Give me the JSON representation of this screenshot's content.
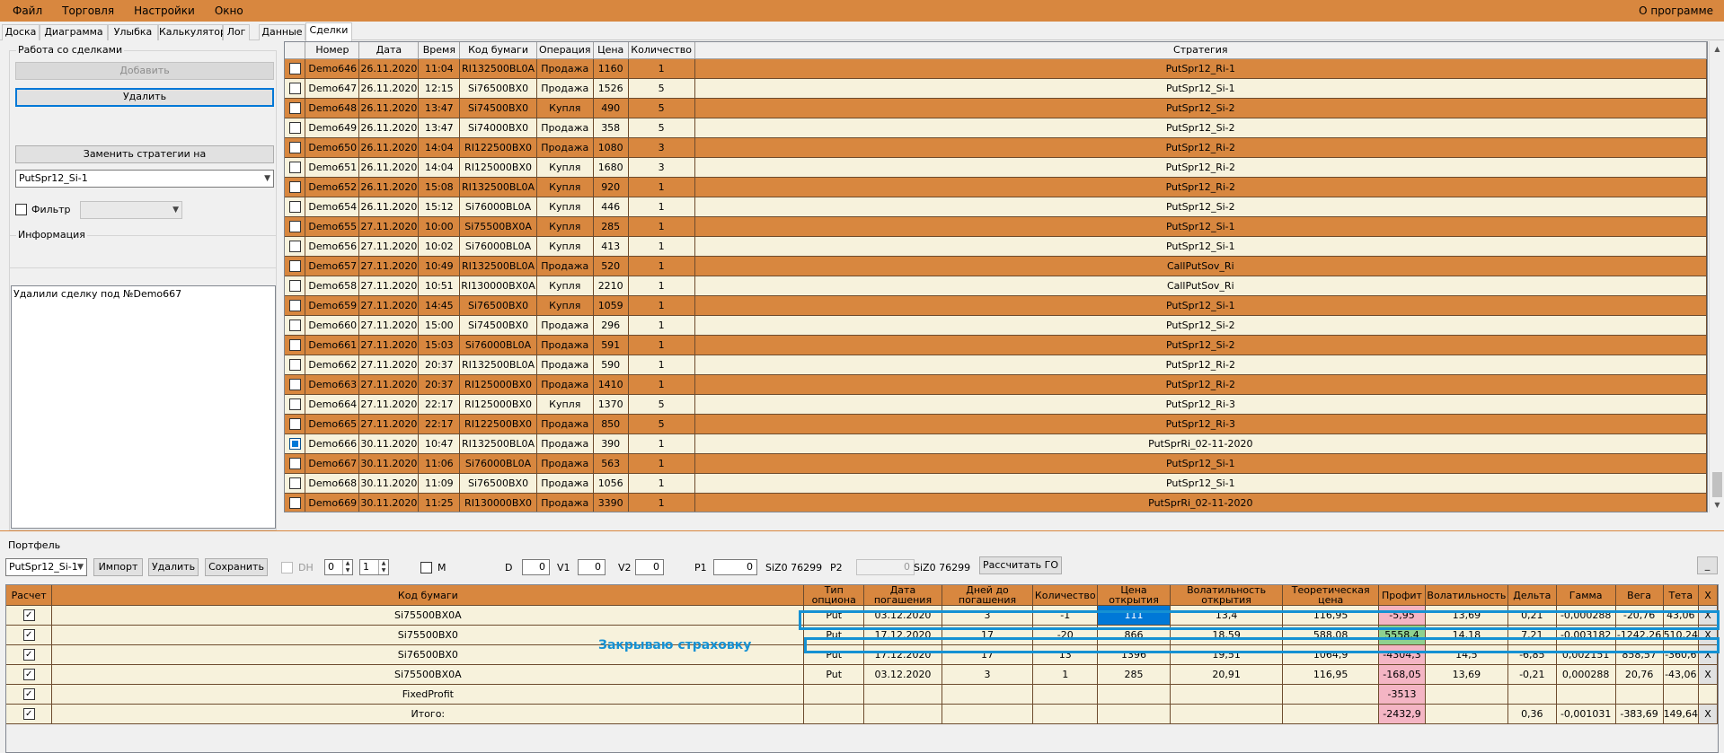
{
  "menu": {
    "items": [
      "Файл",
      "Торговля",
      "Настройки",
      "Окно"
    ],
    "about": "О программе"
  },
  "tabs": [
    "Доска",
    "Диаграмма",
    "Улыбка",
    "Калькулятор",
    "Лог",
    "Данные",
    "Сделки"
  ],
  "active_tab": "Сделки",
  "deals_panel": {
    "title": "Работа со сделками",
    "add_label": "Добавить",
    "delete_label": "Удалить",
    "replace_label": "Заменить стратегии на",
    "strategy_value": "PutSpr12_Si-1",
    "filter_label": "Фильтр",
    "filter_value": ""
  },
  "info": {
    "title": "Информация",
    "text": "Удалили сделку под №Demo667"
  },
  "deals": {
    "columns": [
      "",
      "Номер",
      "Дата",
      "Время",
      "Код бумаги",
      "Операция",
      "Цена",
      "Количество",
      "Стратегия"
    ],
    "rows": [
      [
        "Demo646",
        "26.11.2020",
        "11:04",
        "RI132500BL0A",
        "Продажа",
        "1160",
        "1",
        "PutSpr12_Ri-1"
      ],
      [
        "Demo647",
        "26.11.2020",
        "12:15",
        "Si76500BX0",
        "Продажа",
        "1526",
        "5",
        "PutSpr12_Si-1"
      ],
      [
        "Demo648",
        "26.11.2020",
        "13:47",
        "Si74500BX0",
        "Купля",
        "490",
        "5",
        "PutSpr12_Si-2"
      ],
      [
        "Demo649",
        "26.11.2020",
        "13:47",
        "Si74000BX0",
        "Продажа",
        "358",
        "5",
        "PutSpr12_Si-2"
      ],
      [
        "Demo650",
        "26.11.2020",
        "14:04",
        "RI122500BX0",
        "Продажа",
        "1080",
        "3",
        "PutSpr12_Ri-2"
      ],
      [
        "Demo651",
        "26.11.2020",
        "14:04",
        "RI125000BX0",
        "Купля",
        "1680",
        "3",
        "PutSpr12_Ri-2"
      ],
      [
        "Demo652",
        "26.11.2020",
        "15:08",
        "RI132500BL0A",
        "Купля",
        "920",
        "1",
        "PutSpr12_Ri-2"
      ],
      [
        "Demo654",
        "26.11.2020",
        "15:12",
        "Si76000BL0A",
        "Купля",
        "446",
        "1",
        "PutSpr12_Si-2"
      ],
      [
        "Demo655",
        "27.11.2020",
        "10:00",
        "Si75500BX0A",
        "Купля",
        "285",
        "1",
        "PutSpr12_Si-1"
      ],
      [
        "Demo656",
        "27.11.2020",
        "10:02",
        "Si76000BL0A",
        "Купля",
        "413",
        "1",
        "PutSpr12_Si-1"
      ],
      [
        "Demo657",
        "27.11.2020",
        "10:49",
        "RI132500BL0A",
        "Продажа",
        "520",
        "1",
        "CallPutSov_Ri"
      ],
      [
        "Demo658",
        "27.11.2020",
        "10:51",
        "RI130000BX0A",
        "Купля",
        "2210",
        "1",
        "CallPutSov_Ri"
      ],
      [
        "Demo659",
        "27.11.2020",
        "14:45",
        "Si76500BX0",
        "Купля",
        "1059",
        "1",
        "PutSpr12_Si-1"
      ],
      [
        "Demo660",
        "27.11.2020",
        "15:00",
        "Si74500BX0",
        "Продажа",
        "296",
        "1",
        "PutSpr12_Si-2"
      ],
      [
        "Demo661",
        "27.11.2020",
        "15:03",
        "Si76000BL0A",
        "Продажа",
        "591",
        "1",
        "PutSpr12_Si-2"
      ],
      [
        "Demo662",
        "27.11.2020",
        "20:37",
        "RI132500BL0A",
        "Продажа",
        "590",
        "1",
        "PutSpr12_Ri-2"
      ],
      [
        "Demo663",
        "27.11.2020",
        "20:37",
        "RI125000BX0",
        "Продажа",
        "1410",
        "1",
        "PutSpr12_Ri-2"
      ],
      [
        "Demo664",
        "27.11.2020",
        "22:17",
        "RI125000BX0",
        "Купля",
        "1370",
        "5",
        "PutSpr12_Ri-3"
      ],
      [
        "Demo665",
        "27.11.2020",
        "22:17",
        "RI122500BX0",
        "Продажа",
        "850",
        "5",
        "PutSpr12_Ri-3"
      ],
      [
        "Demo666",
        "30.11.2020",
        "10:47",
        "RI132500BL0A",
        "Продажа",
        "390",
        "1",
        "PutSprRi_02-11-2020"
      ],
      [
        "Demo667",
        "30.11.2020",
        "11:06",
        "Si76000BL0A",
        "Продажа",
        "563",
        "1",
        "PutSpr12_Si-1"
      ],
      [
        "Demo668",
        "30.11.2020",
        "11:09",
        "Si76500BX0",
        "Продажа",
        "1056",
        "1",
        "PutSpr12_Si-1"
      ],
      [
        "Demo669",
        "30.11.2020",
        "11:25",
        "RI130000BX0",
        "Продажа",
        "3390",
        "1",
        "PutSprRi_02-11-2020"
      ]
    ],
    "selected_row": 19
  },
  "portfolio": {
    "title": "Портфель",
    "select_value": "PutSpr12_Si-1",
    "import_label": "Импорт",
    "delete_label": "Удалить",
    "save_label": "Сохранить",
    "dh_label": "DH",
    "dh_val1": "0",
    "dh_val2": "1",
    "m_label": "M",
    "d_label": "D",
    "d_value": "0",
    "v1_label": "V1",
    "v1_value": "0",
    "v2_label": "V2",
    "v2_value": "0",
    "p1_label": "P1",
    "p1_value": "0",
    "sizo1": "SiZ0 76299",
    "p2_label": "P2",
    "p2_value": "0",
    "sizo2": "SiZ0 76299",
    "calc_label": "Рассчитать ГО",
    "min_label": "_",
    "annotation": "Закрываю страховку",
    "columns": [
      "Расчет",
      "Код бумаги",
      "Тип опциона",
      "Дата погашения",
      "Дней до погашения",
      "Количество",
      "Цена открытия",
      "Волатильность открытия",
      "Теоретическая цена",
      "Профит",
      "Волатильность",
      "Дельта",
      "Гамма",
      "Вега",
      "Тета",
      "X"
    ],
    "rows": [
      [
        "Si75500BX0A",
        "Put",
        "03.12.2020",
        "3",
        "-1",
        "111",
        "13,4",
        "116,95",
        "-5,95",
        "13,69",
        "0,21",
        "-0,000288",
        "-20,76",
        "43,06",
        "X"
      ],
      [
        "Si75500BX0",
        "Put",
        "17.12.2020",
        "17",
        "-20",
        "866",
        "18,59",
        "588,08",
        "5558,4",
        "14,18",
        "7,21",
        "-0,003182",
        "-1242,26",
        "510,24",
        "X"
      ],
      [
        "Si76500BX0",
        "Put",
        "17.12.2020",
        "17",
        "13",
        "1396",
        "19,51",
        "1064,9",
        "-4304,3",
        "14,5",
        "-6,85",
        "0,002151",
        "858,57",
        "-360,6",
        "X"
      ],
      [
        "Si75500BX0A",
        "Put",
        "03.12.2020",
        "3",
        "1",
        "285",
        "20,91",
        "116,95",
        "-168,05",
        "13,69",
        "-0,21",
        "0,000288",
        "20,76",
        "-43,06",
        "X"
      ],
      [
        "FixedProfit",
        "",
        "",
        "",
        "",
        "",
        "",
        "",
        "-3513",
        "",
        "",
        "",
        "",
        "",
        ""
      ],
      [
        "Итого:",
        "",
        "",
        "",
        "",
        "",
        "",
        "",
        "-2432,9",
        "",
        "0,36",
        "-0,001031",
        "-383,69",
        "149,64",
        "X"
      ]
    ],
    "profit_colors": [
      "pink",
      "green",
      "pink",
      "pink",
      "pink",
      "pink"
    ]
  }
}
